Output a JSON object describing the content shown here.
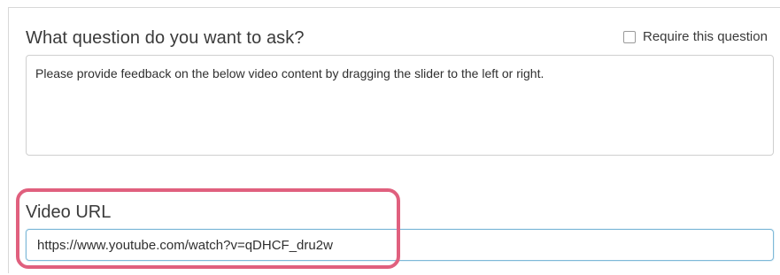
{
  "question": {
    "label": "What question do you want to ask?",
    "require_label": "Require this question",
    "require_checked": false,
    "text": "Please provide feedback on the below video content by dragging the slider to the left or right."
  },
  "video": {
    "label": "Video URL",
    "url_value": "https://www.youtube.com/watch?v=qDHCF_dru2w"
  },
  "colors": {
    "highlight": "#e0607e",
    "input_focus_border": "#7fb9d8"
  }
}
